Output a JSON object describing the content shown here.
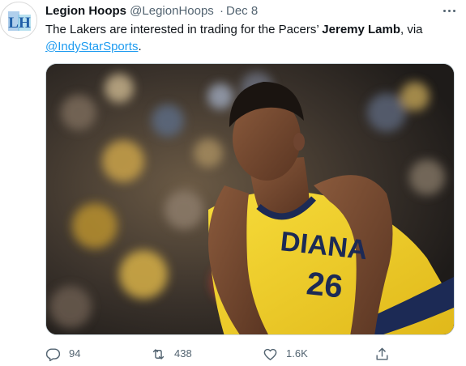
{
  "tweet": {
    "author_name": "Legion Hoops",
    "author_handle": "@LegionHoops",
    "separator": "·",
    "date": "Dec 8",
    "text_before": "The Lakers are interested in trading for the Pacers’ ",
    "text_bold": "Jeremy Lamb",
    "text_after_bold": ", via",
    "mention": "@IndyStarSports",
    "text_end": ".",
    "avatar_logo_text": "LH"
  },
  "media": {
    "jersey_text": "DIANA",
    "jersey_number": "26"
  },
  "actions": {
    "reply_count": "94",
    "retweet_count": "438",
    "like_count": "1.6K"
  },
  "colors": {
    "text": "#0f1419",
    "secondary": "#536471",
    "link": "#1d9bf0",
    "jersey_yellow": "#f5d323",
    "jersey_navy": "#1c2a55"
  },
  "icons": {
    "reply": "reply-icon",
    "retweet": "retweet-icon",
    "like": "heart-icon",
    "share": "share-icon",
    "more": "more-horizontal-icon"
  }
}
